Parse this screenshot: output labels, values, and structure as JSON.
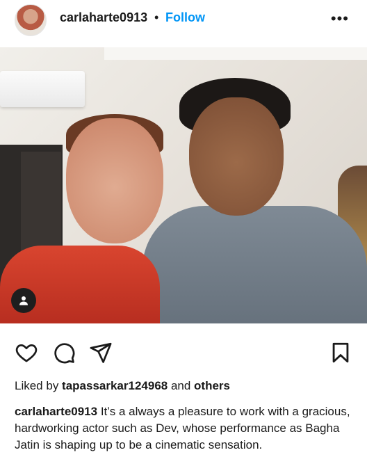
{
  "post": {
    "username": "carlaharte0913",
    "separator": "•",
    "follow_label": "Follow",
    "more_icon": "more-horizontal-icon",
    "photo_alt": "",
    "tag_icon": "user-tag-icon"
  },
  "actions": {
    "like_icon": "heart-icon",
    "comment_icon": "comment-icon",
    "share_icon": "send-icon",
    "save_icon": "bookmark-icon"
  },
  "likes": {
    "prefix": "Liked by ",
    "user": "tapassarkar124968",
    "middle": " and ",
    "suffix": "others"
  },
  "caption": {
    "username": "carlaharte0913",
    "text": " It’s a always a pleasure to work with a gracious, hardworking actor such as Dev, whose performance as Bagha Jatin is shaping up to be a cinematic sensation."
  },
  "colors": {
    "follow": "#0095f6",
    "text": "#1a1a1a",
    "background": "#ffffff"
  }
}
